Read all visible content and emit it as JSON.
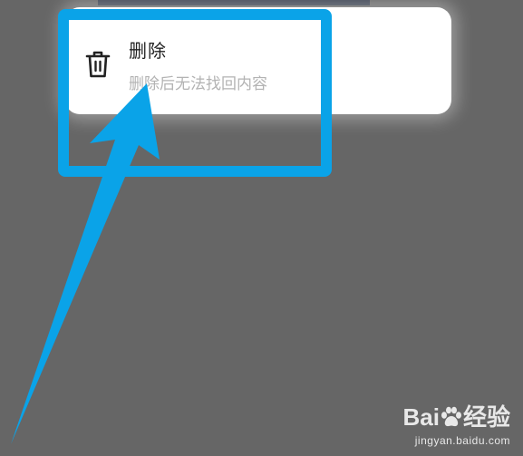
{
  "menu": {
    "delete_title": "删除",
    "delete_desc": "删除后无法找回内容",
    "icon": "trash-icon"
  },
  "annotation": {
    "highlight_color": "#0aa3e8"
  },
  "watermark": {
    "brand_left": "Bai",
    "brand_right": "经验",
    "url": "jingyan.baidu.com"
  }
}
